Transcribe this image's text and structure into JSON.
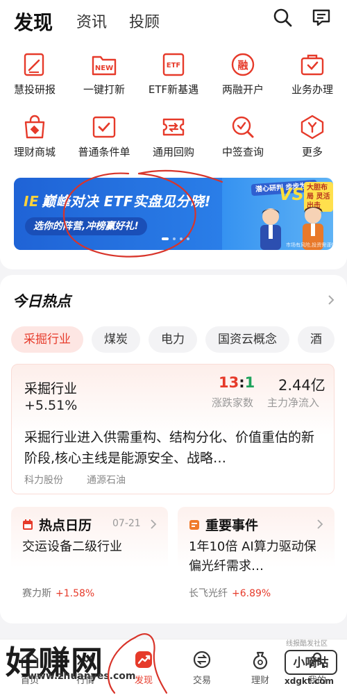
{
  "header": {
    "tabs": [
      {
        "label": "发现",
        "active": true
      },
      {
        "label": "资讯",
        "active": false
      },
      {
        "label": "投顾",
        "active": false
      }
    ],
    "icons": [
      "search-icon",
      "message-icon"
    ]
  },
  "quick_menu": [
    {
      "label": "慧投研报",
      "icon": "report-icon"
    },
    {
      "label": "一键打新",
      "icon": "new-stock-icon",
      "badge": "NEW"
    },
    {
      "label": "ETF新基遇",
      "icon": "etf-icon",
      "badge": "ETF"
    },
    {
      "label": "两融开户",
      "icon": "margin-icon",
      "badge": "融"
    },
    {
      "label": "业务办理",
      "icon": "briefcase-icon"
    },
    {
      "label": "理财商城",
      "icon": "mall-bag-icon"
    },
    {
      "label": "普通条件单",
      "icon": "condition-order-icon"
    },
    {
      "label": "通用回购",
      "icon": "repo-ticket-icon"
    },
    {
      "label": "中签查询",
      "icon": "lottery-search-icon"
    },
    {
      "label": "更多",
      "icon": "more-icon"
    }
  ],
  "banner": {
    "title_prefix": "IE",
    "title": "巅峰对决 ETF实盘见分晓!",
    "subtitle": "选你的阵营,冲榜赢好礼!",
    "tag_left": "潜心研判 步步为赢",
    "vs": "VS",
    "tag_right": "大胆布局 灵活出击",
    "footnote": "市场有风险,投资需谨慎",
    "pager_total": 4,
    "pager_active": 1
  },
  "hot": {
    "title": "今日热点",
    "chips": [
      {
        "label": "采掘行业",
        "active": true
      },
      {
        "label": "煤炭",
        "active": false
      },
      {
        "label": "电力",
        "active": false
      },
      {
        "label": "国资云概念",
        "active": false
      },
      {
        "label": "酒",
        "active": false
      }
    ],
    "detail": {
      "name": "采掘行业",
      "change": "+5.51%",
      "up_count": "13",
      "separator": ":",
      "down_count": "1",
      "ratio_label": "涨跌家数",
      "net_inflow": "2.44亿",
      "net_inflow_label": "主力净流入",
      "description": "采掘行业进入供需重构、结构分化、价值重估的新阶段,核心主线是能源安全、战略…",
      "stocks": [
        "科力股份",
        "通源石油"
      ]
    },
    "calendar": {
      "title": "热点日历",
      "date": "07-21",
      "body": "交运设备二级行业",
      "stock": "赛力斯",
      "change": "+1.58%"
    },
    "event": {
      "title": "重要事件",
      "body": "1年10倍 AI算力驱动保偏光纤需求…",
      "stock": "长飞光纤",
      "change": "+6.89%"
    }
  },
  "bottom_nav": [
    {
      "label": "首页",
      "icon": "home-icon",
      "active": false
    },
    {
      "label": "行情",
      "icon": "market-icon",
      "active": false
    },
    {
      "label": "发现",
      "icon": "discover-icon",
      "active": true
    },
    {
      "label": "交易",
      "icon": "trade-icon",
      "active": false
    },
    {
      "label": "理财",
      "icon": "wealth-icon",
      "active": false
    },
    {
      "label": "我的",
      "icon": "profile-icon",
      "active": false
    }
  ],
  "watermark": {
    "left_logo": "好赚网",
    "left_url": "www.zhuanyes.com",
    "right_top": "线报酷发社区",
    "right_logo": "小嘀咕",
    "right_url": "xdgkt.com"
  },
  "colors": {
    "accent": "#e63a2a",
    "banner_blue": "#2a7ee8",
    "up": "#e63a2a",
    "down": "#1ea35c"
  }
}
